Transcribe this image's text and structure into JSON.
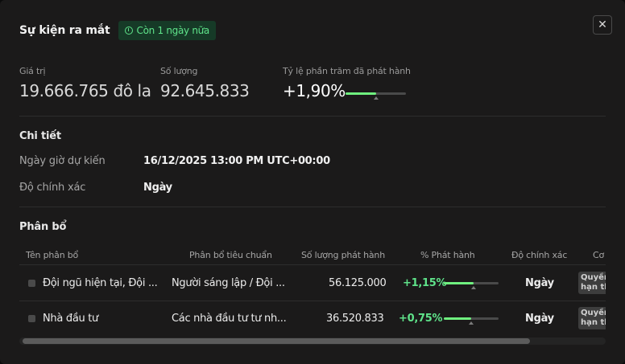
{
  "header": {
    "title": "Sự kiện ra mắt",
    "badge": "Còn 1 ngày nữa",
    "close_label": "✕"
  },
  "stats": [
    {
      "label": "Giá trị",
      "value": "19.666.765 đô la"
    },
    {
      "label": "Số lượng",
      "value": "92.645.833"
    },
    {
      "label": "Tỷ lệ phần trăm đã phát hành",
      "value": "+1,90%",
      "progress": 0.5
    }
  ],
  "details": {
    "title": "Chi tiết",
    "rows": [
      {
        "label": "Ngày giờ dự kiến",
        "value": "16/12/2025 13:00 PM UTC+00:00"
      },
      {
        "label": "Độ chính xác",
        "value": "Ngày"
      }
    ]
  },
  "allocation": {
    "title": "Phân bổ",
    "columns": [
      "Tên phân bổ",
      "Phân bổ tiêu chuẩn",
      "Số lượng phát hành",
      "% Phát hành",
      "Độ chính xác",
      "Cơ"
    ],
    "rows": [
      {
        "name": "Đội ngũ hiện tại, Đội ...",
        "standard": "Người sáng lập / Đội ...",
        "amount": "56.125.000",
        "percent": "+1,15%",
        "progress": 0.55,
        "precision": "Ngày",
        "tag": "Quyền hạn th"
      },
      {
        "name": "Nhà đầu tư",
        "standard": "Các nhà đầu tư tư nh...",
        "amount": "36.520.833",
        "percent": "+0,75%",
        "progress": 0.5,
        "precision": "Ngày",
        "tag": "Quyền hạn th"
      }
    ]
  },
  "colors": {
    "accent": "#6ff07f",
    "badge_bg": "#163a27",
    "background": "#1b1a1a"
  },
  "icons": {
    "badge": "clock-icon",
    "close": "close-icon"
  }
}
